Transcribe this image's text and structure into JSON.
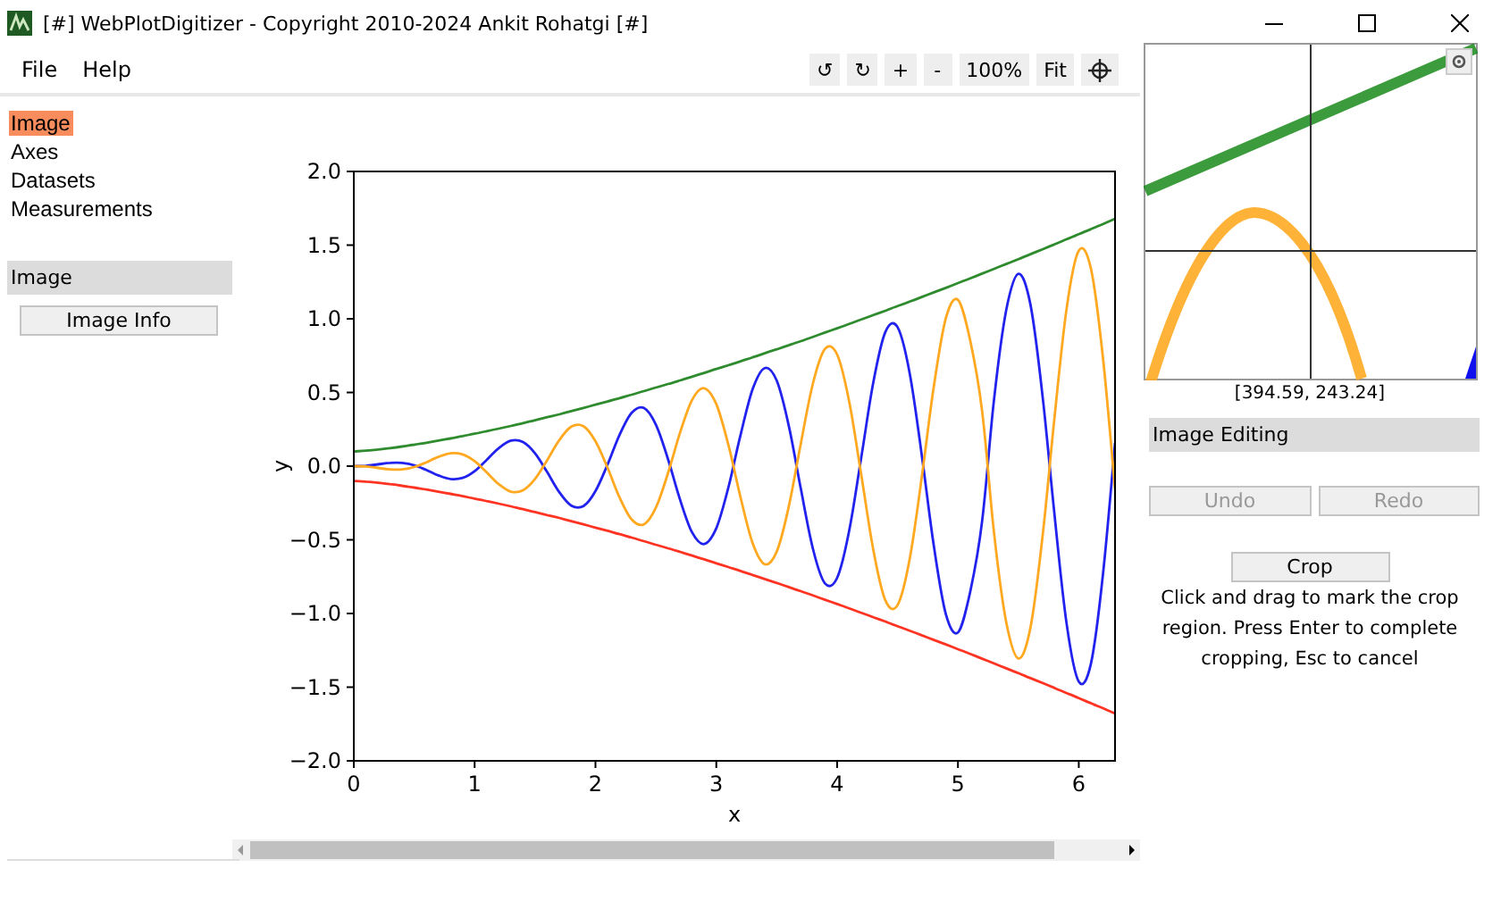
{
  "window": {
    "title": "[#] WebPlotDigitizer - Copyright 2010-2024 Ankit Rohatgi [#]"
  },
  "menu": [
    "File",
    "Help"
  ],
  "toolbar": [
    {
      "kind": "text",
      "label": "↺"
    },
    {
      "kind": "text",
      "label": "↻"
    },
    {
      "kind": "text",
      "label": "+"
    },
    {
      "kind": "text",
      "label": "-"
    },
    {
      "kind": "text",
      "label": "100%"
    },
    {
      "kind": "text",
      "label": "Fit"
    },
    {
      "kind": "crosshair"
    }
  ],
  "sidebar": {
    "items": [
      {
        "label": "Image",
        "selected": true
      },
      {
        "label": "Axes",
        "selected": false
      },
      {
        "label": "Datasets",
        "selected": false
      },
      {
        "label": "Measurements",
        "selected": false
      }
    ],
    "section": {
      "title": "Image",
      "button": "Image Info"
    }
  },
  "plot": {
    "chart_data": {
      "type": "line",
      "xlabel": "x",
      "ylabel": "y",
      "xlim": [
        0,
        6.3
      ],
      "ylim": [
        -2,
        2
      ],
      "xticks": [
        0,
        1,
        2,
        3,
        4,
        5,
        6
      ],
      "yticks": [
        {
          "value": -2,
          "label": "−2.0"
        },
        {
          "value": -1.5,
          "label": "−1.5"
        },
        {
          "value": -1,
          "label": "−1.0"
        },
        {
          "value": -0.5,
          "label": "−0.5"
        },
        {
          "value": 0,
          "label": "0.0"
        },
        {
          "value": 0.5,
          "label": "0.5"
        },
        {
          "value": 1,
          "label": "1.0"
        },
        {
          "value": 1.5,
          "label": "1.5"
        },
        {
          "value": 2,
          "label": "2.0"
        }
      ],
      "x": [
        0,
        0.1,
        0.2,
        0.3,
        0.4,
        0.5,
        0.6,
        0.7,
        0.8,
        0.9,
        1,
        1.1,
        1.2,
        1.3,
        1.4,
        1.5,
        1.6,
        1.7,
        1.8,
        1.9,
        2,
        2.1,
        2.2,
        2.3,
        2.4,
        2.5,
        2.6,
        2.7,
        2.8,
        2.9,
        3,
        3.1,
        3.2,
        3.3,
        3.4,
        3.5,
        3.6,
        3.7,
        3.8,
        3.9,
        4,
        4.1,
        4.2,
        4.3,
        4.4,
        4.5,
        4.6,
        4.7,
        4.8,
        4.9,
        5,
        5.1,
        5.2,
        5.3,
        5.4,
        5.5,
        5.6,
        5.7,
        5.8,
        5.9,
        6,
        6.1,
        6.2,
        6.3
      ],
      "series": [
        {
          "color": "#2e8b2e",
          "values": [
            0.1,
            0.105,
            0.113,
            0.122,
            0.133,
            0.146,
            0.159,
            0.173,
            0.188,
            0.204,
            0.22,
            0.237,
            0.255,
            0.273,
            0.292,
            0.312,
            0.332,
            0.352,
            0.373,
            0.395,
            0.417,
            0.439,
            0.462,
            0.485,
            0.509,
            0.533,
            0.557,
            0.582,
            0.607,
            0.633,
            0.659,
            0.685,
            0.712,
            0.738,
            0.766,
            0.793,
            0.821,
            0.849,
            0.878,
            0.907,
            0.936,
            0.965,
            0.995,
            1.025,
            1.055,
            1.086,
            1.116,
            1.148,
            1.179,
            1.21,
            1.242,
            1.274,
            1.307,
            1.339,
            1.372,
            1.405,
            1.439,
            1.472,
            1.506,
            1.54,
            1.574,
            1.609,
            1.643,
            1.679
          ]
        },
        {
          "color": "#ff3322",
          "values": [
            -0.1,
            -0.105,
            -0.113,
            -0.122,
            -0.133,
            -0.146,
            -0.159,
            -0.173,
            -0.188,
            -0.204,
            -0.22,
            -0.237,
            -0.255,
            -0.273,
            -0.292,
            -0.312,
            -0.332,
            -0.352,
            -0.373,
            -0.395,
            -0.417,
            -0.439,
            -0.462,
            -0.485,
            -0.509,
            -0.533,
            -0.557,
            -0.582,
            -0.607,
            -0.633,
            -0.659,
            -0.685,
            -0.712,
            -0.738,
            -0.766,
            -0.793,
            -0.821,
            -0.849,
            -0.878,
            -0.907,
            -0.936,
            -0.965,
            -0.995,
            -1.025,
            -1.055,
            -1.086,
            -1.116,
            -1.148,
            -1.179,
            -1.21,
            -1.242,
            -1.274,
            -1.307,
            -1.339,
            -1.372,
            -1.405,
            -1.439,
            -1.472,
            -1.506,
            -1.54,
            -1.574,
            -1.609,
            -1.643,
            -1.679
          ]
        },
        {
          "color": "#2222ee",
          "values": [
            0,
            0.003,
            0.012,
            0.022,
            0.022,
            0.006,
            -0.026,
            -0.063,
            -0.087,
            -0.08,
            -0.034,
            0.043,
            0.123,
            0.173,
            0.164,
            0.087,
            -0.04,
            -0.177,
            -0.268,
            -0.271,
            -0.17,
            0.011,
            0.214,
            0.363,
            0.395,
            0.282,
            0.049,
            -0.228,
            -0.45,
            -0.529,
            -0.42,
            -0.145,
            0.21,
            0.52,
            0.666,
            0.58,
            0.275,
            -0.155,
            -0.564,
            -0.796,
            -0.757,
            -0.439,
            0.06,
            0.572,
            0.911,
            0.943,
            0.635,
            0.078,
            -0.541,
            -1.004,
            -1.129,
            -0.856,
            -0.375,
            0.464,
            1.059,
            1.305,
            1.095,
            0.48,
            -0.337,
            -1.076,
            -1.462,
            -1.342,
            -0.739,
            0.159
          ]
        },
        {
          "color": "#ffa820",
          "values": [
            0,
            -0.003,
            -0.012,
            -0.022,
            -0.022,
            -0.006,
            0.026,
            0.063,
            0.087,
            0.08,
            0.034,
            -0.043,
            -0.123,
            -0.173,
            -0.164,
            -0.087,
            0.04,
            0.177,
            0.268,
            0.271,
            0.17,
            -0.011,
            -0.214,
            -0.363,
            -0.395,
            -0.282,
            -0.049,
            0.228,
            0.45,
            0.529,
            0.42,
            0.145,
            -0.21,
            -0.52,
            -0.666,
            -0.58,
            -0.275,
            0.155,
            0.564,
            0.796,
            0.757,
            0.439,
            -0.06,
            -0.572,
            -0.911,
            -0.943,
            -0.635,
            -0.078,
            0.541,
            1.004,
            1.129,
            0.856,
            0.375,
            -0.464,
            -1.059,
            -1.305,
            -1.095,
            -0.48,
            0.337,
            1.076,
            1.462,
            1.342,
            0.739,
            -0.159
          ]
        }
      ]
    }
  },
  "magnifier": {
    "coordinates": "[394.59, 243.24]"
  },
  "image_editing": {
    "title": "Image Editing",
    "buttons": [
      {
        "label": "Undo",
        "disabled": true
      },
      {
        "label": "Redo",
        "disabled": true
      }
    ],
    "crop_button": "Crop",
    "help": "Click and drag to mark the crop region. Press Enter to complete cropping, Esc to cancel"
  }
}
